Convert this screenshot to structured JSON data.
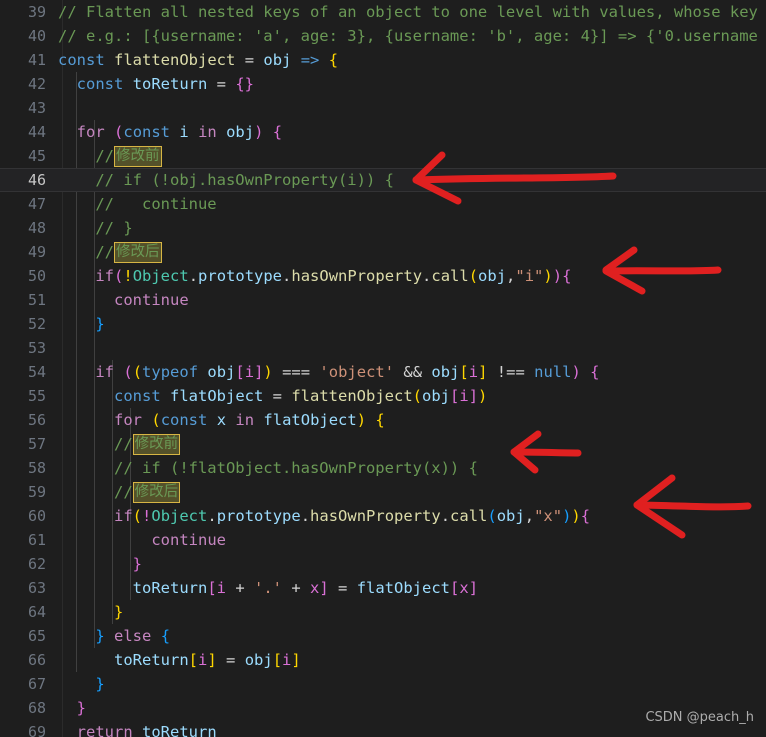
{
  "editor": {
    "theme_background": "#1e1e1e",
    "active_line_background": "#232325",
    "active_line_number": 46,
    "first_visible_line": 39,
    "last_visible_line": 69,
    "language": "javascript"
  },
  "annotations": {
    "before_label": "修改前",
    "after_label": "修改后",
    "highlight_border_color": "#d7b544",
    "highlight_background_color": "#54512a",
    "arrow_color": "#e02020",
    "arrow_count": 4,
    "arrows": [
      {
        "name": "arrow-line-46",
        "points_to_line": 46
      },
      {
        "name": "arrow-line-50",
        "points_to_line": 50
      },
      {
        "name": "arrow-line-58",
        "points_to_line": 58
      },
      {
        "name": "arrow-line-60",
        "points_to_line": 60
      }
    ]
  },
  "watermark": {
    "text": "CSDN @peach_h"
  },
  "lines": [
    {
      "num": "39",
      "text": "// Flatten all nested keys of an object to one level with values, whose key"
    },
    {
      "num": "40",
      "text": "// e.g.: [{username: 'a', age: 3}, {username: 'b', age: 4}] => {'0.username"
    },
    {
      "num": "41",
      "text": "const flattenObject = obj => {"
    },
    {
      "num": "42",
      "text": "  const toReturn = {}"
    },
    {
      "num": "43",
      "text": ""
    },
    {
      "num": "44",
      "text": "  for (const i in obj) {"
    },
    {
      "num": "45",
      "text": "    //修改前"
    },
    {
      "num": "46",
      "text": "    // if (!obj.hasOwnProperty(i)) {"
    },
    {
      "num": "47",
      "text": "    //   continue"
    },
    {
      "num": "48",
      "text": "    // }"
    },
    {
      "num": "49",
      "text": "    //修改后"
    },
    {
      "num": "50",
      "text": "    if(!Object.prototype.hasOwnProperty.call(obj,\"i\")){"
    },
    {
      "num": "51",
      "text": "      continue"
    },
    {
      "num": "52",
      "text": "    }"
    },
    {
      "num": "53",
      "text": ""
    },
    {
      "num": "54",
      "text": "    if ((typeof obj[i]) === 'object' && obj[i] !== null) {"
    },
    {
      "num": "55",
      "text": "      const flatObject = flattenObject(obj[i])"
    },
    {
      "num": "56",
      "text": "      for (const x in flatObject) {"
    },
    {
      "num": "57",
      "text": "      //修改前"
    },
    {
      "num": "58",
      "text": "      // if (!flatObject.hasOwnProperty(x)) {"
    },
    {
      "num": "59",
      "text": "      //修改后"
    },
    {
      "num": "60",
      "text": "      if(!Object.prototype.hasOwnProperty.call(obj,\"x\")){"
    },
    {
      "num": "61",
      "text": "          continue"
    },
    {
      "num": "62",
      "text": "        }"
    },
    {
      "num": "63",
      "text": "        toReturn[i + '.' + x] = flatObject[x]"
    },
    {
      "num": "64",
      "text": "      }"
    },
    {
      "num": "65",
      "text": "    } else {"
    },
    {
      "num": "66",
      "text": "      toReturn[i] = obj[i]"
    },
    {
      "num": "67",
      "text": "    }"
    },
    {
      "num": "68",
      "text": "  }"
    },
    {
      "num": "69",
      "text": "  return toReturn"
    }
  ],
  "line_numbers": {
    "n39": "39",
    "n40": "40",
    "n41": "41",
    "n42": "42",
    "n43": "43",
    "n44": "44",
    "n45": "45",
    "n46": "46",
    "n47": "47",
    "n48": "48",
    "n49": "49",
    "n50": "50",
    "n51": "51",
    "n52": "52",
    "n53": "53",
    "n54": "54",
    "n55": "55",
    "n56": "56",
    "n57": "57",
    "n58": "58",
    "n59": "59",
    "n60": "60",
    "n61": "61",
    "n62": "62",
    "n63": "63",
    "n64": "64",
    "n65": "65",
    "n66": "66",
    "n67": "67",
    "n68": "68",
    "n69": "69"
  }
}
